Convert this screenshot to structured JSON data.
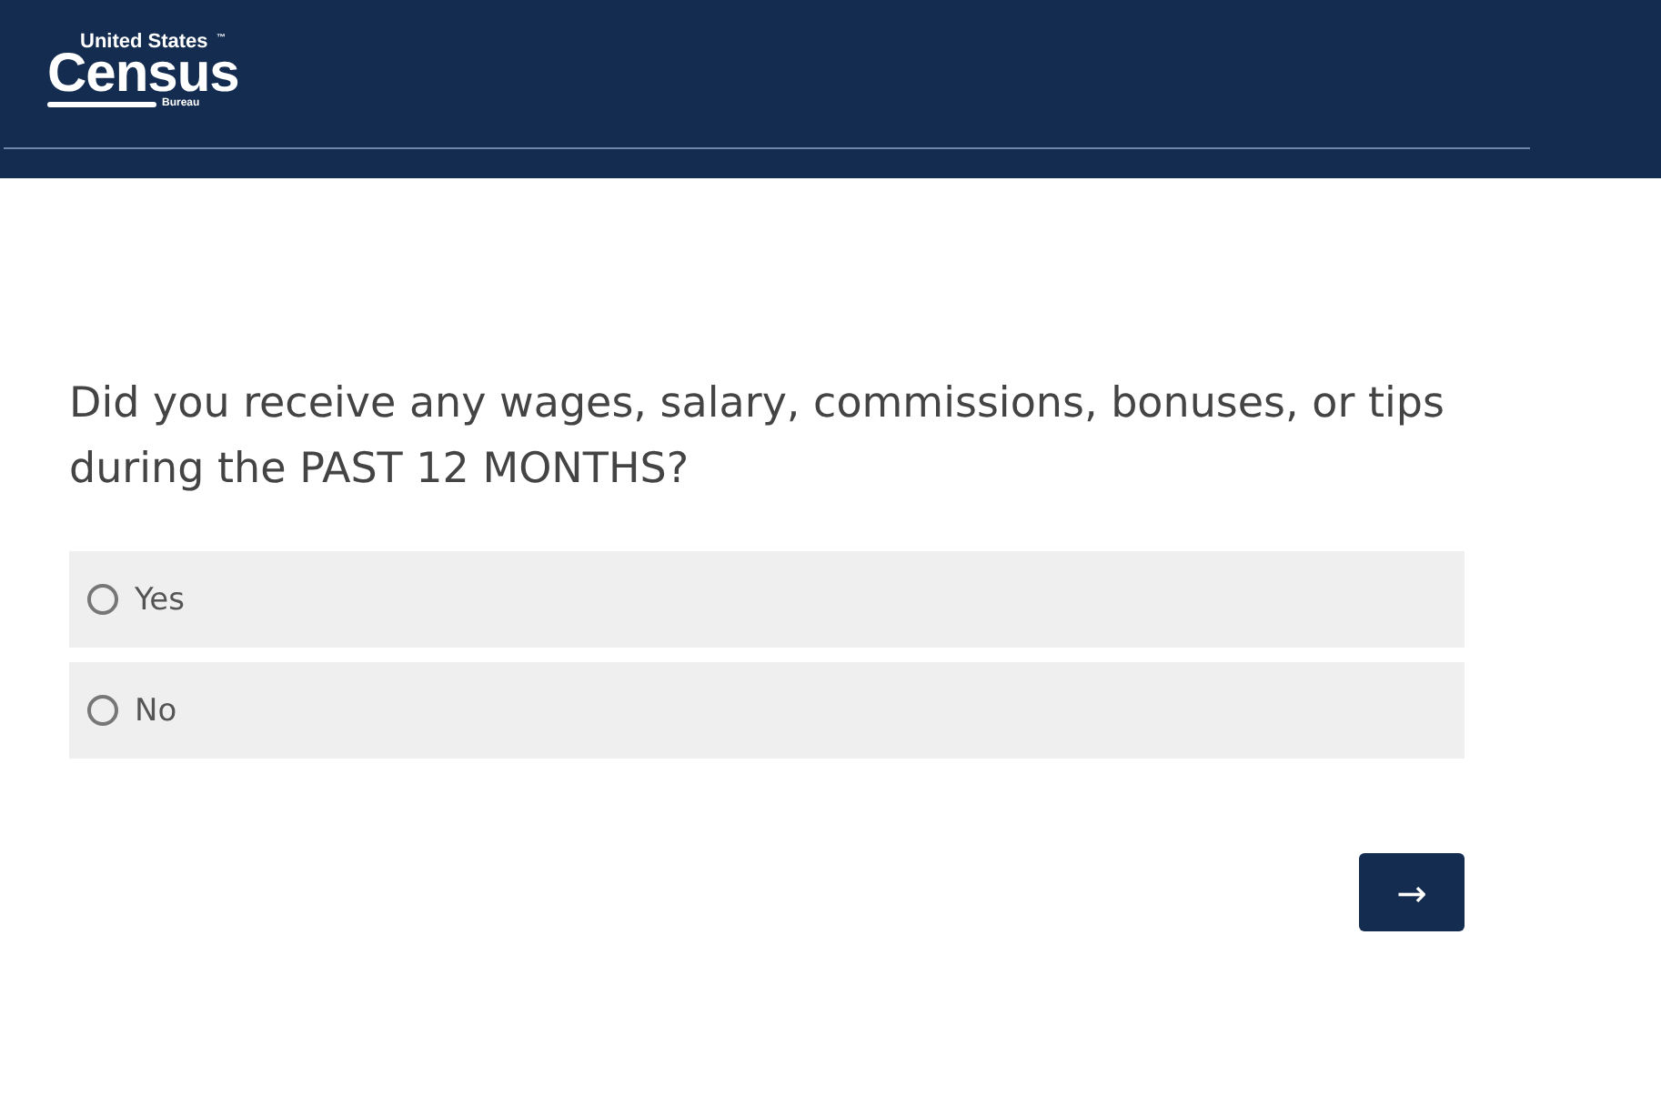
{
  "header": {
    "logo": {
      "top": "United States",
      "mark": "™",
      "main": "Census",
      "sub": "Bureau"
    }
  },
  "question": "Did you receive any wages, salary, commissions, bonuses, or tips during the PAST 12 MONTHS?",
  "options": [
    {
      "label": "Yes",
      "selected": false
    },
    {
      "label": "No",
      "selected": false
    }
  ],
  "next_button": {
    "label": "→"
  }
}
